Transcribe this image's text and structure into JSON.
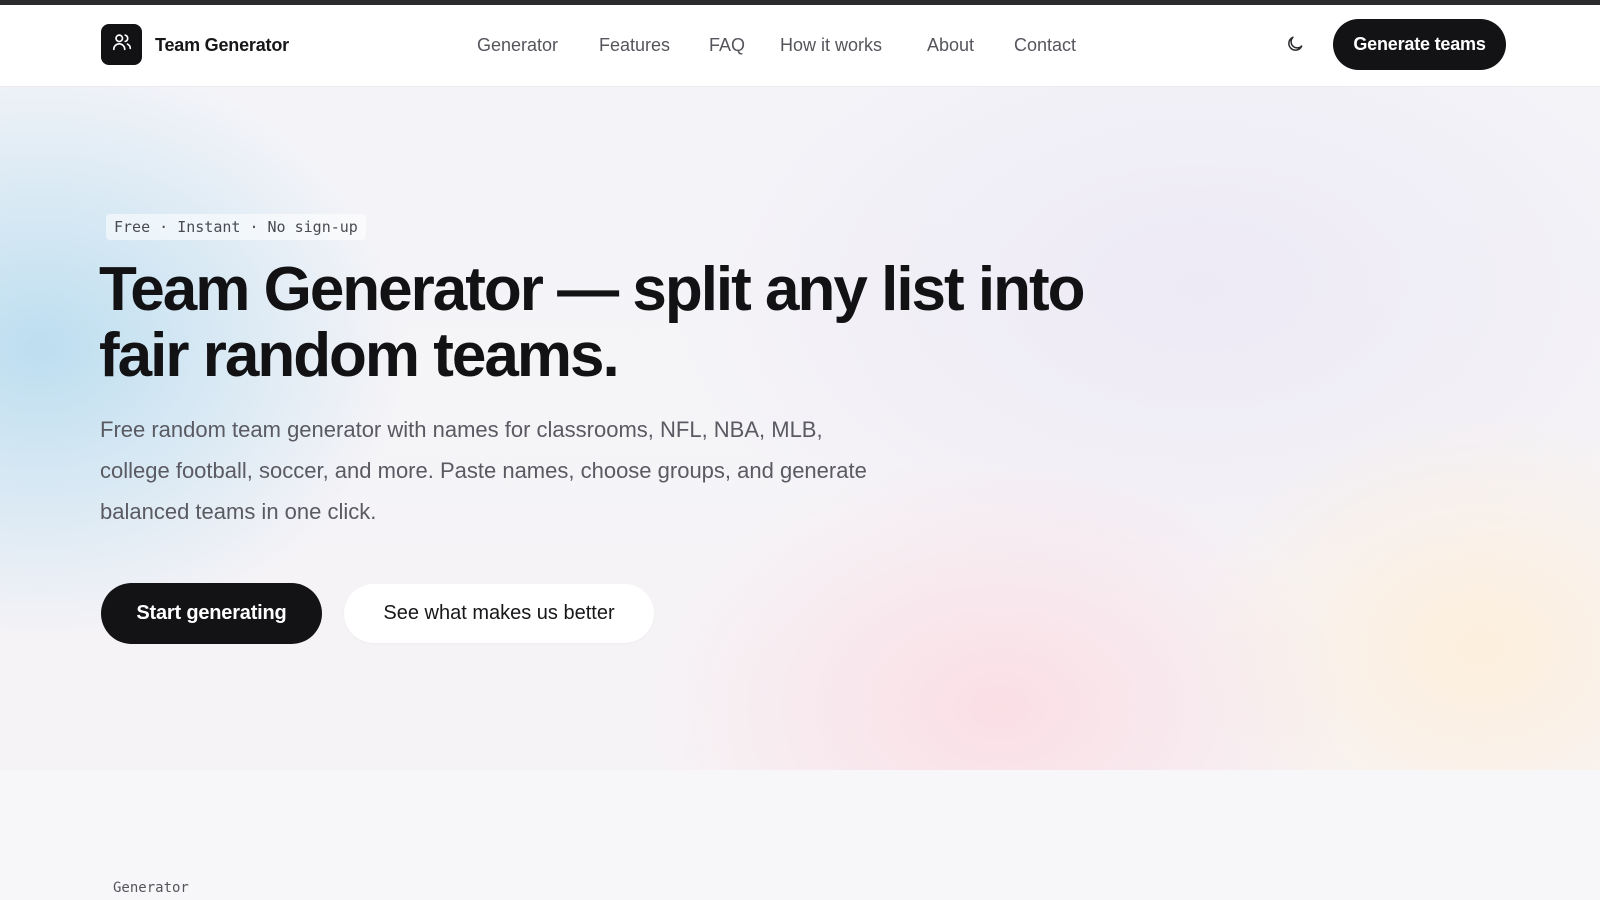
{
  "header": {
    "brand": "Team Generator",
    "nav": [
      "Generator",
      "Features",
      "FAQ",
      "How it works",
      "About",
      "Contact"
    ],
    "cta": "Generate teams",
    "theme_icon": "moon-icon",
    "logo_icon": "users-icon"
  },
  "hero": {
    "badge": "Free · Instant · No sign-up",
    "title_line1": "Team Generator — split any list into",
    "title_line2": "fair random teams.",
    "subtitle_line1": "Free random team generator with names for classrooms, NFL, NBA, MLB,",
    "subtitle_line2": "college football, soccer, and more. Paste names, choose groups, and generate",
    "subtitle_line3": "balanced teams in one click.",
    "primary_button": "Start generating",
    "secondary_button": "See what makes us better"
  },
  "next_section": {
    "label": "Generator"
  },
  "colors": {
    "dark": "#131316",
    "muted_text": "#5a5a63",
    "nav_text": "#55555c"
  }
}
